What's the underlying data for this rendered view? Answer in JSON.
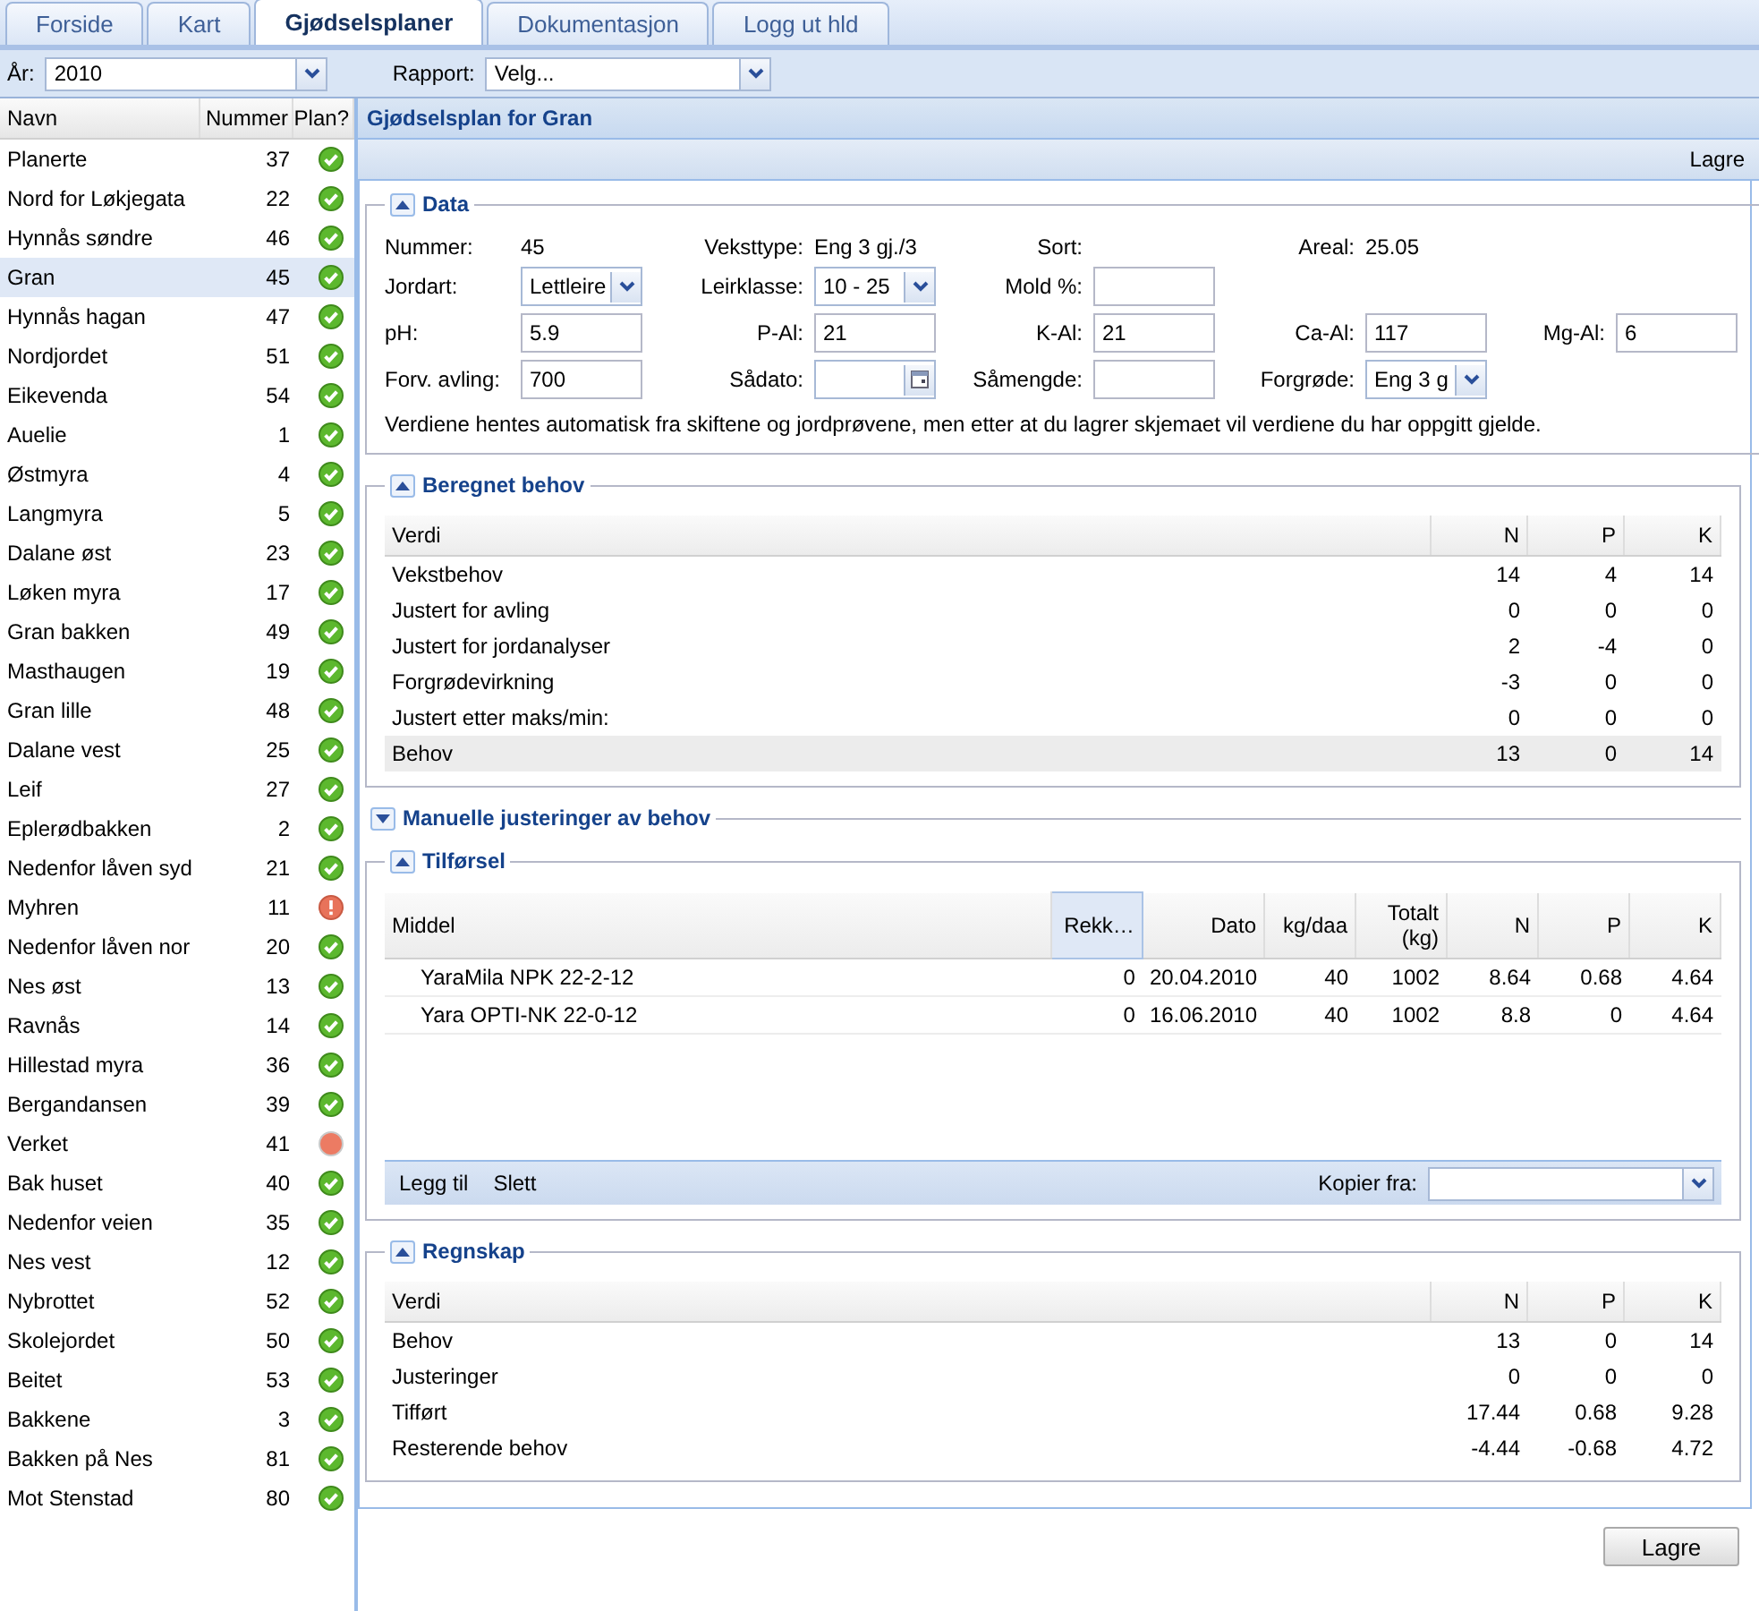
{
  "tabs": [
    {
      "label": "Forside",
      "selected": false
    },
    {
      "label": "Kart",
      "selected": false
    },
    {
      "label": "Gjødselsplaner",
      "selected": true
    },
    {
      "label": "Dokumentasjon",
      "selected": false
    },
    {
      "label": "Logg ut hld",
      "selected": false
    }
  ],
  "toolbar": {
    "year_label": "År:",
    "year": "2010",
    "report_label": "Rapport:",
    "report": "Velg..."
  },
  "sidebar": {
    "columns": [
      "Navn",
      "Nummer",
      "Plan?"
    ],
    "rows": [
      {
        "name": "Planerte",
        "number": "37",
        "kind": "ok",
        "selected": false
      },
      {
        "name": "Nord for Løkjegata",
        "number": "22",
        "kind": "ok",
        "selected": false
      },
      {
        "name": "Hynnås søndre",
        "number": "46",
        "kind": "ok",
        "selected": false
      },
      {
        "name": "Gran",
        "number": "45",
        "kind": "ok",
        "selected": true
      },
      {
        "name": "Hynnås hagan",
        "number": "47",
        "kind": "ok",
        "selected": false
      },
      {
        "name": "Nordjordet",
        "number": "51",
        "kind": "ok",
        "selected": false
      },
      {
        "name": "Eikevenda",
        "number": "54",
        "kind": "ok",
        "selected": false
      },
      {
        "name": "Auelie",
        "number": "1",
        "kind": "ok",
        "selected": false
      },
      {
        "name": "Østmyra",
        "number": "4",
        "kind": "ok",
        "selected": false
      },
      {
        "name": "Langmyra",
        "number": "5",
        "kind": "ok",
        "selected": false
      },
      {
        "name": "Dalane øst",
        "number": "23",
        "kind": "ok",
        "selected": false
      },
      {
        "name": "Løken myra",
        "number": "17",
        "kind": "ok",
        "selected": false
      },
      {
        "name": "Gran bakken",
        "number": "49",
        "kind": "ok",
        "selected": false
      },
      {
        "name": "Masthaugen",
        "number": "19",
        "kind": "ok",
        "selected": false
      },
      {
        "name": "Gran lille",
        "number": "48",
        "kind": "ok",
        "selected": false
      },
      {
        "name": "Dalane vest",
        "number": "25",
        "kind": "ok",
        "selected": false
      },
      {
        "name": "Leif",
        "number": "27",
        "kind": "ok",
        "selected": false
      },
      {
        "name": "Eplerødbakken",
        "number": "2",
        "kind": "ok",
        "selected": false
      },
      {
        "name": "Nedenfor låven syd",
        "number": "21",
        "kind": "ok",
        "selected": false
      },
      {
        "name": "Myhren",
        "number": "11",
        "kind": "warning",
        "selected": false
      },
      {
        "name": "Nedenfor låven nor",
        "number": "20",
        "kind": "ok",
        "selected": false
      },
      {
        "name": "Nes øst",
        "number": "13",
        "kind": "ok",
        "selected": false
      },
      {
        "name": "Ravnås",
        "number": "14",
        "kind": "ok",
        "selected": false
      },
      {
        "name": "Hillestad myra",
        "number": "36",
        "kind": "ok",
        "selected": false
      },
      {
        "name": "Bergandansen",
        "number": "39",
        "kind": "ok",
        "selected": false
      },
      {
        "name": "Verket",
        "number": "41",
        "kind": "missing",
        "selected": false
      },
      {
        "name": "Bak huset",
        "number": "40",
        "kind": "ok",
        "selected": false
      },
      {
        "name": "Nedenfor veien",
        "number": "35",
        "kind": "ok",
        "selected": false
      },
      {
        "name": "Nes vest",
        "number": "12",
        "kind": "ok",
        "selected": false
      },
      {
        "name": "Nybrottet",
        "number": "52",
        "kind": "ok",
        "selected": false
      },
      {
        "name": "Skolejordet",
        "number": "50",
        "kind": "ok",
        "selected": false
      },
      {
        "name": "Beitet",
        "number": "53",
        "kind": "ok",
        "selected": false
      },
      {
        "name": "Bakkene",
        "number": "3",
        "kind": "ok",
        "selected": false
      },
      {
        "name": "Bakken på Nes",
        "number": "81",
        "kind": "ok",
        "selected": false
      },
      {
        "name": "Mot Stenstad",
        "number": "80",
        "kind": "ok",
        "selected": false
      }
    ]
  },
  "panel": {
    "title": "Gjødselsplan for Gran",
    "save": "Lagre",
    "sections": [
      {
        "kind": "form",
        "title": "Data",
        "expanded": true,
        "rows": [
          [
            {
              "label": "Nummer:",
              "kind": "text",
              "value": "45"
            },
            {
              "label": "Veksttype:",
              "kind": "text",
              "value": "Eng 3 gj./3"
            },
            {
              "label": "Sort:",
              "kind": "text"
            },
            {
              "label": "Areal:",
              "kind": "text",
              "value": "25.05"
            }
          ],
          [
            {
              "label": "Jordart:",
              "kind": "select",
              "value": "Lettleire"
            },
            {
              "label": "Leirklasse:",
              "kind": "select",
              "value": "10 - 25"
            },
            {
              "label": "Mold %:",
              "kind": "input"
            }
          ],
          [
            {
              "label": "pH:",
              "kind": "input",
              "value": "5.9"
            },
            {
              "label": "P-Al:",
              "kind": "input",
              "value": "21"
            },
            {
              "label": "K-Al:",
              "kind": "input",
              "value": "21"
            },
            {
              "label": "Ca-Al:",
              "kind": "input",
              "value": "117"
            },
            {
              "label": "Mg-Al:",
              "kind": "input",
              "value": "6"
            }
          ],
          [
            {
              "label": "Forv. avling:",
              "kind": "input",
              "value": "700"
            },
            {
              "label": "Sådato:",
              "kind": "date"
            },
            {
              "label": "Såmengde:",
              "kind": "input"
            },
            {
              "label": "Forgrøde:",
              "kind": "select",
              "value": "Eng 3 g"
            }
          ]
        ],
        "note": "Verdiene hentes automatisk fra skiftene og jordprøvene, men etter at du lagrer skjemaet vil verdiene du har oppgitt gjelde."
      },
      {
        "kind": "table",
        "title": "Beregnet behov",
        "expanded": true,
        "columns": [
          "Verdi",
          "N",
          "P",
          "K"
        ],
        "rows": [
          {
            "cells": [
              "Vekstbehov",
              "14",
              "4",
              "14"
            ],
            "selected": false
          },
          {
            "cells": [
              "Justert for avling",
              "0",
              "0",
              "0"
            ],
            "selected": false
          },
          {
            "cells": [
              "Justert for jordanalyser",
              "2",
              "-4",
              "0"
            ],
            "selected": false
          },
          {
            "cells": [
              "Forgrødevirkning",
              "-3",
              "0",
              "0"
            ],
            "selected": false
          },
          {
            "cells": [
              "Justert etter maks/min:",
              "0",
              "0",
              "0"
            ],
            "selected": false
          },
          {
            "cells": [
              "Behov",
              "13",
              "0",
              "14"
            ],
            "selected": true
          }
        ]
      },
      {
        "kind": "table",
        "title": "Manuelle justeringer av behov",
        "expanded": false
      },
      {
        "kind": "grid",
        "title": "Tilførsel",
        "expanded": true,
        "columns": [
          {
            "label": "Middel",
            "selected": false
          },
          {
            "label": "Rekk…",
            "selected": true
          },
          {
            "label": "Dato",
            "selected": false
          },
          {
            "label": "kg/daa",
            "selected": false
          },
          {
            "label": "Totalt (kg)",
            "selected": false
          },
          {
            "label": "N",
            "selected": false
          },
          {
            "label": "P",
            "selected": false
          },
          {
            "label": "K",
            "selected": false
          }
        ],
        "rows": [
          [
            "YaraMila NPK 22-2-12",
            "0",
            "20.04.2010",
            "40",
            "1002",
            "8.64",
            "0.68",
            "4.64"
          ],
          [
            "Yara OPTI-NK 22-0-12",
            "0",
            "16.06.2010",
            "40",
            "1002",
            "8.8",
            "0",
            "4.64"
          ]
        ],
        "actions": [
          "Legg til",
          "Slett"
        ],
        "copy_label": "Kopier fra:"
      },
      {
        "kind": "table",
        "title": "Regnskap",
        "expanded": true,
        "columns": [
          "Verdi",
          "N",
          "P",
          "K"
        ],
        "rows": [
          {
            "cells": [
              "Behov",
              "13",
              "0",
              "14"
            ],
            "selected": false
          },
          {
            "cells": [
              "Justeringer",
              "0",
              "0",
              "0"
            ],
            "selected": false
          },
          {
            "cells": [
              "Tifført",
              "17.44",
              "0.68",
              "9.28"
            ],
            "selected": false
          },
          {
            "cells": [
              "Resterende behov",
              "-4.44",
              "-0.68",
              "4.72"
            ],
            "selected": false
          }
        ]
      }
    ]
  },
  "footer": {
    "save": "Lagre"
  }
}
